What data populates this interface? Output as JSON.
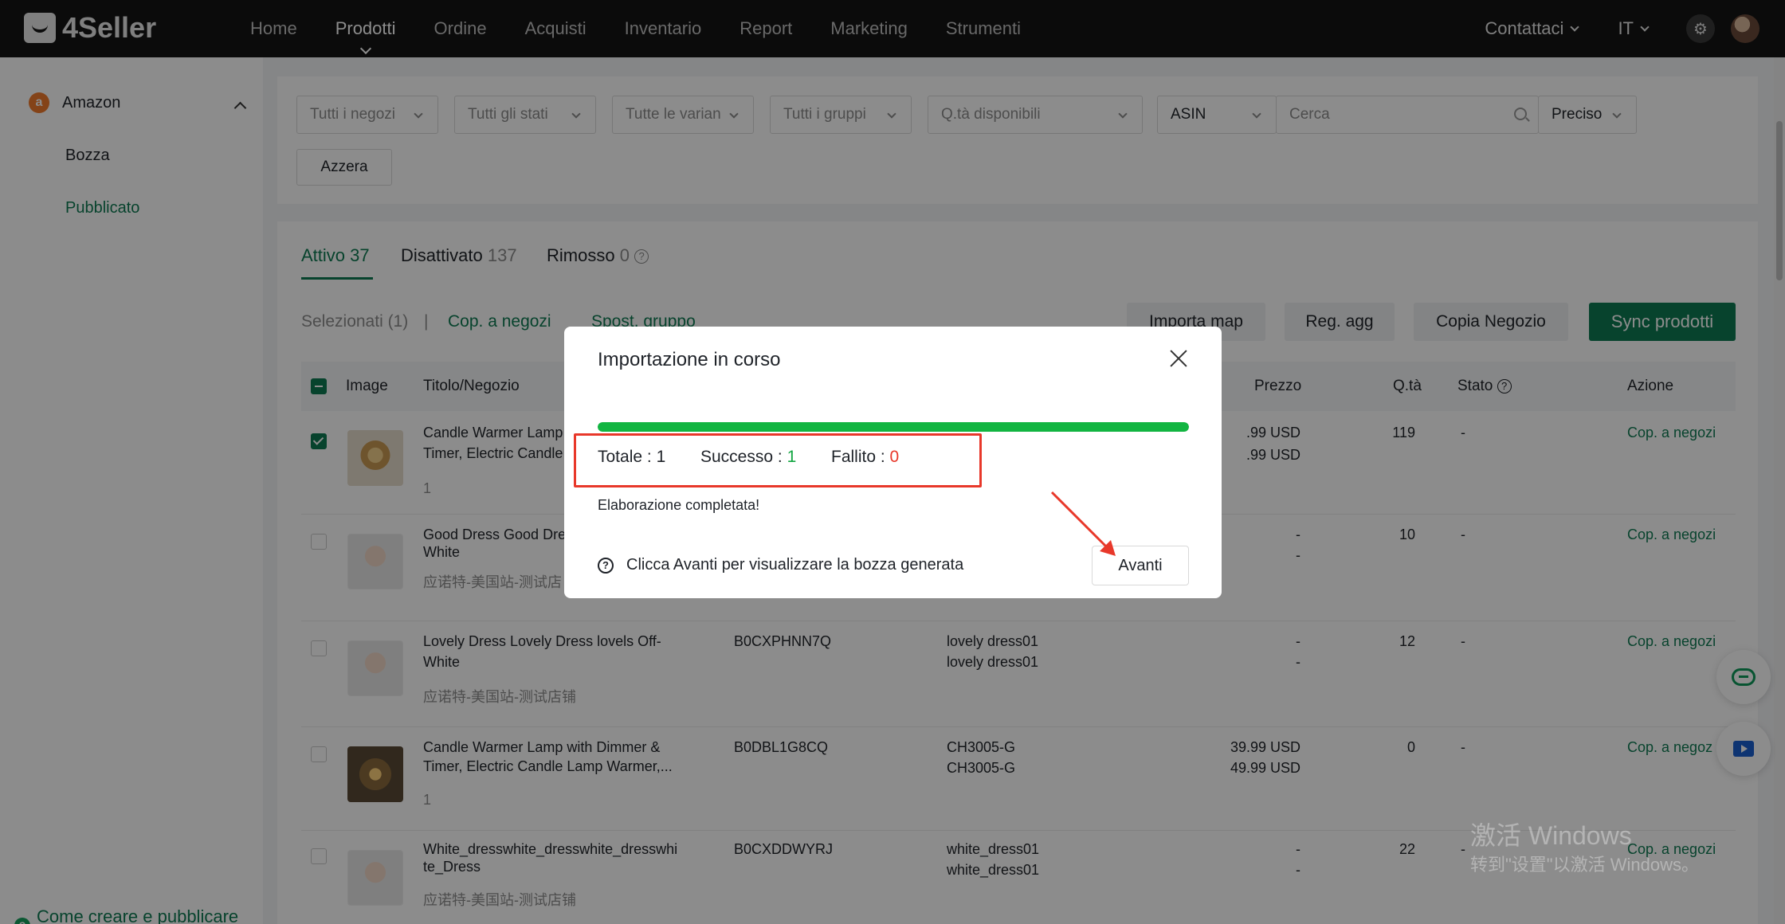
{
  "app": {
    "logo_text": "4Seller"
  },
  "nav": {
    "items": [
      "Home",
      "Prodotti",
      "Ordine",
      "Acquisti",
      "Inventario",
      "Report",
      "Marketing",
      "Strumenti"
    ],
    "active": "Prodotti",
    "contact": "Contattaci",
    "language": "IT"
  },
  "sidebar": {
    "platform": "Amazon",
    "items": [
      "Bozza",
      "Pubblicato"
    ],
    "active": "Pubblicato",
    "help": "Come creare e pubblicare articoli?"
  },
  "filters": {
    "stores": "Tutti i negozi",
    "states": "Tutti gli stati",
    "variants": "Tutte le varian",
    "groups": "Tutti i gruppi",
    "qty": "Q.tà disponibili",
    "search_field": "ASIN",
    "search_placeholder": "Cerca",
    "match": "Preciso",
    "reset": "Azzera"
  },
  "tabs": [
    {
      "label": "Attivo",
      "count": "37"
    },
    {
      "label": "Disattivato",
      "count": "137"
    },
    {
      "label": "Rimosso",
      "count": "0"
    }
  ],
  "toolbar": {
    "selected": "Selezionati (1)",
    "separator": "|",
    "copy_to_stores": "Cop. a negozi",
    "move_group": "Spost. gruppo",
    "import_map": "Importa map",
    "reg_update": "Reg. agg",
    "copy_store": "Copia Negozio",
    "sync": "Sync prodotti"
  },
  "table": {
    "headers": {
      "image": "Image",
      "title": "Titolo/Negozio",
      "price": "Prezzo",
      "qty": "Q.tà",
      "status": "Stato",
      "action": "Azione"
    },
    "rows": [
      {
        "title": "Candle Warmer Lamp",
        "title2": "Timer, Electric Candle",
        "store": "1",
        "asin": "",
        "sku1": "",
        "sku2": "",
        "price1": ".99 USD",
        "price2": ".99 USD",
        "qty": "119",
        "status": "-",
        "action": "Cop. a negozi",
        "checked": true,
        "thumb": "candle"
      },
      {
        "title": "Good Dress Good Dre",
        "title2": "White",
        "store": "应诺特-美国站-测试店",
        "asin": "",
        "sku1": "",
        "sku2": "",
        "price1": "-",
        "price2": "-",
        "qty": "10",
        "status": "-",
        "action": "Cop. a negozi",
        "checked": false,
        "thumb": "baby"
      },
      {
        "title": "Lovely Dress Lovely Dress lovels Off-",
        "title2": "White",
        "store": "应诺特-美国站-测试店铺",
        "asin": "B0CXPHNN7Q",
        "sku1": "lovely dress01",
        "sku2": "lovely dress01",
        "price1": "-",
        "price2": "-",
        "qty": "12",
        "status": "-",
        "action": "Cop. a negozi",
        "checked": false,
        "thumb": "baby"
      },
      {
        "title": "Candle Warmer Lamp with Dimmer &",
        "title2": "Timer, Electric Candle Lamp Warmer,...",
        "store": "1",
        "asin": "B0DBL1G8CQ",
        "sku1": "CH3005-G",
        "sku2": "CH3005-G",
        "price1": "39.99 USD",
        "price2": "49.99 USD",
        "qty": "0",
        "status": "-",
        "action": "Cop. a negoz",
        "checked": false,
        "thumb": "candle2"
      },
      {
        "title": "White_dresswhite_dresswhite_dresswhi",
        "title2": "te_Dress",
        "store": "应诺特-美国站-测试店铺",
        "asin": "B0CXDDWYRJ",
        "sku1": "white_dress01",
        "sku2": "white_dress01",
        "price1": "-",
        "price2": "-",
        "qty": "22",
        "status": "-",
        "action": "Cop. a negozi",
        "checked": false,
        "thumb": "baby"
      }
    ]
  },
  "modal": {
    "title": "Importazione in corso",
    "progress": 1.0,
    "total_label": "Totale",
    "total": "1",
    "success_label": "Successo",
    "success": "1",
    "failed_label": "Fallito",
    "failed": "0",
    "message": "Elaborazione completata!",
    "hint": "Clicca Avanti per visualizzare la bozza generata",
    "next_button": "Avanti"
  },
  "watermark": {
    "line1": "激活 Windows",
    "line2": "转到\"设置\"以激活 Windows。"
  },
  "colors": {
    "brand_green": "#0e7a52",
    "progress_green": "#12b541",
    "annotation_red": "#e8382a",
    "topbar": "#141414"
  }
}
